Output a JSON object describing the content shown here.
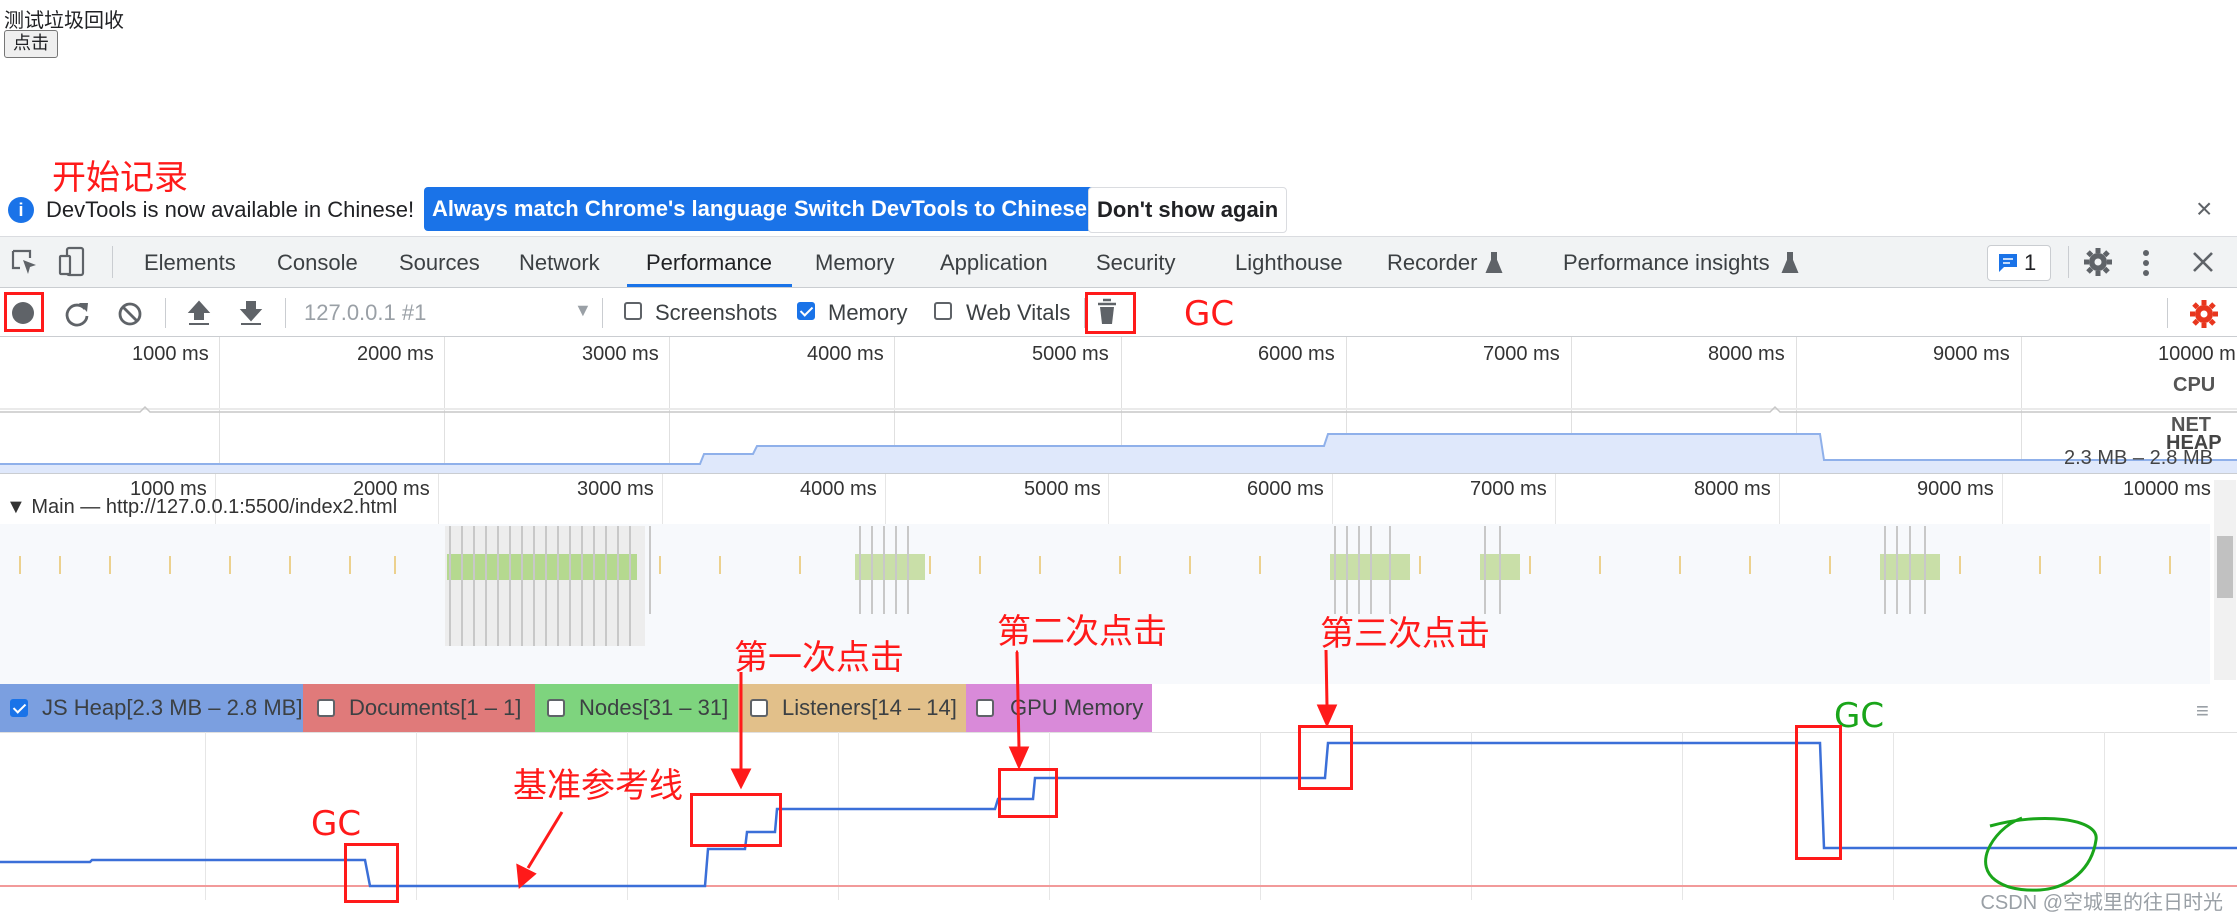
{
  "page": {
    "title": "测试垃圾回收",
    "button_label": "点击"
  },
  "infobar": {
    "message": "DevTools is now available in Chinese!",
    "buttons": [
      "Always match Chrome's language",
      "Switch DevTools to Chinese",
      "Don't show again"
    ],
    "close_symbol": "×"
  },
  "tabs": [
    "Elements",
    "Console",
    "Sources",
    "Network",
    "Performance",
    "Memory",
    "Application",
    "Security",
    "Lighthouse",
    "Recorder",
    "Performance insights"
  ],
  "active_tab": "Performance",
  "issues_count": "1",
  "toolbar": {
    "target": "127.0.0.1 #1",
    "options": [
      {
        "label": "Screenshots",
        "checked": false
      },
      {
        "label": "Memory",
        "checked": true
      },
      {
        "label": "Web Vitals",
        "checked": false
      }
    ]
  },
  "overview": {
    "ticks": [
      "1000 ms",
      "2000 ms",
      "3000 ms",
      "4000 ms",
      "5000 ms",
      "6000 ms",
      "7000 ms",
      "8000 ms",
      "9000 ms",
      "10000 m"
    ],
    "labels": {
      "cpu": "CPU",
      "net": "NET",
      "heap": "HEAP"
    },
    "heap_range": "2.3 MB – 2.8 MB"
  },
  "main": {
    "ticks": [
      "1000 ms",
      "2000 ms",
      "3000 ms",
      "4000 ms",
      "5000 ms",
      "6000 ms",
      "7000 ms",
      "8000 ms",
      "9000 ms",
      "10000 ms"
    ],
    "thread_title": "▼ Main — http://127.0.0.1:5500/index2.html"
  },
  "counters": [
    {
      "label": "JS Heap[2.3 MB – 2.8 MB]",
      "checked": true,
      "color": "#7b9fe0"
    },
    {
      "label": "Documents[1 – 1]",
      "checked": false,
      "color": "#e07a7a"
    },
    {
      "label": "Nodes[31 – 31]",
      "checked": false,
      "color": "#7ed47e"
    },
    {
      "label": "Listeners[14 – 14]",
      "checked": false,
      "color": "#e2c08a"
    },
    {
      "label": "GPU Memory",
      "checked": false,
      "color": "#d98ad9"
    }
  ],
  "annotations": {
    "start_recording": "开始记录",
    "gc_button": "GC",
    "gc_first": "GC",
    "gc_later": "GC",
    "baseline": "基准参考线",
    "click1": "第一次点击",
    "click2": "第二次点击",
    "click3": "第三次点击"
  },
  "watermark": "CSDN @空城里的往日时光",
  "colors": {
    "accent": "#1a73e8",
    "annotation_red": "#ff1a1a",
    "annotation_green": "#1aa51a",
    "heap_line": "#3b6fd8"
  }
}
